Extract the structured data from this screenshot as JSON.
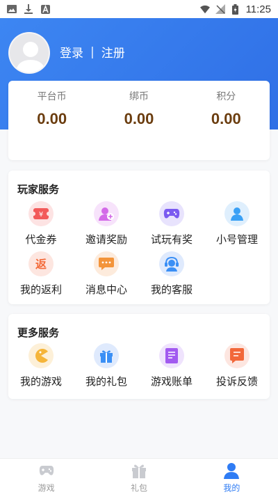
{
  "status_bar": {
    "time": "11:25"
  },
  "header": {
    "login_label": "登录",
    "separator": "|",
    "register_label": "注册"
  },
  "balances": [
    {
      "label": "平台币",
      "value": "0.00"
    },
    {
      "label": "绑币",
      "value": "0.00"
    },
    {
      "label": "积分",
      "value": "0.00"
    }
  ],
  "player_services": {
    "title": "玩家服务",
    "items": [
      {
        "label": "代金券",
        "icon": "coupon-icon",
        "color": "#f25a5a"
      },
      {
        "label": "邀请奖励",
        "icon": "invite-icon",
        "color": "#d36ae8"
      },
      {
        "label": "试玩有奖",
        "icon": "gamepad-icon",
        "color": "#7a5af0"
      },
      {
        "label": "小号管理",
        "icon": "user-icon",
        "color": "#3aa0f5"
      },
      {
        "label": "我的返利",
        "icon": "rebate-icon",
        "color": "#f36b3a"
      },
      {
        "label": "消息中心",
        "icon": "message-icon",
        "color": "#f3943a"
      },
      {
        "label": "我的客服",
        "icon": "service-icon",
        "color": "#3a8ff5"
      }
    ]
  },
  "more_services": {
    "title": "更多服务",
    "items": [
      {
        "label": "我的游戏",
        "icon": "pacman-icon",
        "color": "#f5b53a"
      },
      {
        "label": "我的礼包",
        "icon": "gift-icon",
        "color": "#3a8ff5"
      },
      {
        "label": "游戏账单",
        "icon": "bill-icon",
        "color": "#a25af0"
      },
      {
        "label": "投诉反馈",
        "icon": "feedback-icon",
        "color": "#f2683a"
      }
    ]
  },
  "tabbar": {
    "tabs": [
      {
        "label": "游戏",
        "icon": "game-tab-icon",
        "active": false
      },
      {
        "label": "礼包",
        "icon": "gift-tab-icon",
        "active": false
      },
      {
        "label": "我的",
        "icon": "profile-tab-icon",
        "active": true
      }
    ]
  }
}
